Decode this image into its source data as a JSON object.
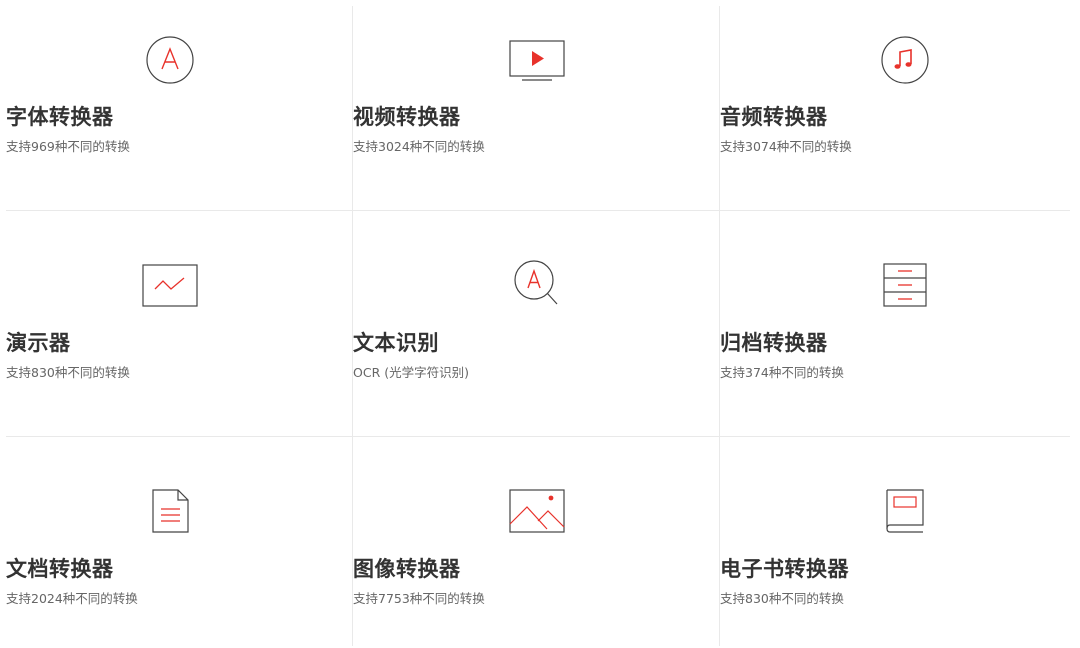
{
  "converters": [
    {
      "icon": "font-icon",
      "title": "字体转换器",
      "description": "支持969种不同的转换"
    },
    {
      "icon": "video-icon",
      "title": "视频转换器",
      "description": "支持3024种不同的转换"
    },
    {
      "icon": "music-note-icon",
      "title": "音频转换器",
      "description": "支持3074种不同的转换"
    },
    {
      "icon": "presentation-icon",
      "title": "演示器",
      "description": "支持830种不同的转换"
    },
    {
      "icon": "ocr-magnifier-icon",
      "title": "文本识别",
      "description": "OCR (光学字符识别)"
    },
    {
      "icon": "archive-icon",
      "title": "归档转换器",
      "description": "支持374种不同的转换"
    },
    {
      "icon": "document-icon",
      "title": "文档转换器",
      "description": "支持2024种不同的转换"
    },
    {
      "icon": "image-icon",
      "title": "图像转换器",
      "description": "支持7753种不同的转换"
    },
    {
      "icon": "ebook-icon",
      "title": "电子书转换器",
      "description": "支持830种不同的转换"
    }
  ],
  "colors": {
    "accent": "#e8322b",
    "icon_stroke": "#444444",
    "title_text": "#333333",
    "description_text": "#666666",
    "divider": "#e9e9e9"
  }
}
